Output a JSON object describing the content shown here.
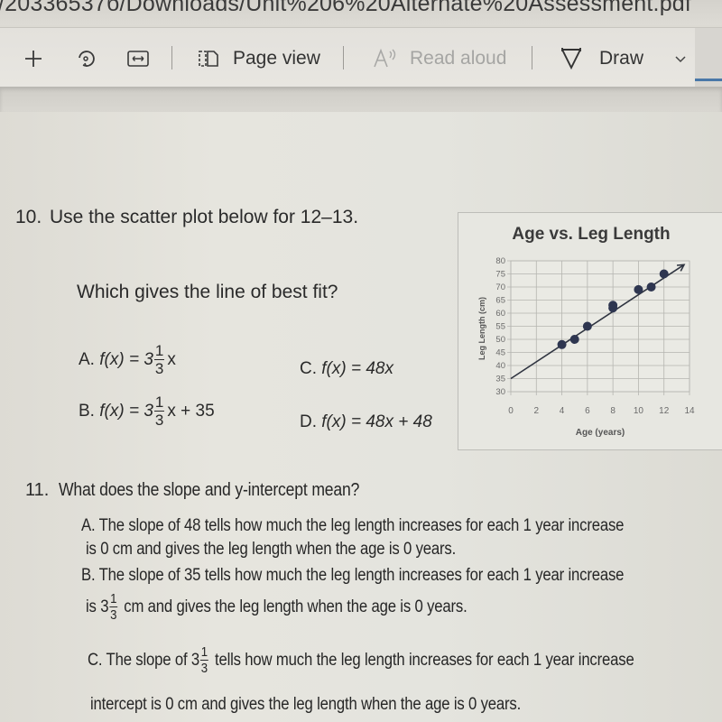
{
  "browser": {
    "url_text": "/20336537б/Downloads/Unit%206%20Alternate%20Assessment.pdf",
    "toolbar": {
      "page_view_label": "Page view",
      "read_aloud_label": "Read aloud",
      "draw_label": "Draw",
      "icons": [
        "plus-icon",
        "rotate-icon",
        "fit-width-icon",
        "page-view-icon",
        "read-aloud-icon",
        "draw-pen-icon",
        "chevron-down-icon"
      ]
    }
  },
  "document": {
    "q10": {
      "number": "10.",
      "prompt": "Use the scatter plot below for 12–13.",
      "question": "Which gives the line of best fit?",
      "choices": {
        "A": {
          "letter": "A.",
          "prefix": "f(x) = 3",
          "frac_num": "1",
          "frac_den": "3",
          "suffix": "x"
        },
        "B": {
          "letter": "B.",
          "prefix": "f(x) = 3",
          "frac_num": "1",
          "frac_den": "3",
          "suffix": "x + 35"
        },
        "C": {
          "letter": "C.",
          "text": "f(x) = 48x"
        },
        "D": {
          "letter": "D.",
          "text": "f(x) = 48x + 48"
        }
      }
    },
    "q11": {
      "number": "11.",
      "prompt": "What does the slope and y-intercept mean?",
      "A": {
        "line1": "A. The slope of 48 tells how much the leg length increases for each 1 year increase",
        "line2": "is 0 cm and gives the leg length when the age is 0 years."
      },
      "B": {
        "line1": "B. The slope of 35 tells how much the leg length increases for each 1 year increase",
        "line2_prefix": "is 3",
        "frac_num": "1",
        "frac_den": "3",
        "line2_suffix": "cm and gives the leg length when the age is 0 years."
      },
      "C": {
        "line1_prefix": "C. The slope of 3",
        "frac_num": "1",
        "frac_den": "3",
        "line1_suffix": "tells how much the leg length increases for each 1 year increase",
        "line2": "intercept is 0 cm and gives the leg length when the age is 0 years."
      }
    }
  },
  "chart_data": {
    "type": "scatter",
    "title": "Age vs. Leg Length",
    "xlabel": "Age (years)",
    "ylabel": "Leg Length (cm)",
    "xlim": [
      0,
      14
    ],
    "ylim": [
      30,
      80
    ],
    "xticks": [
      0,
      2,
      4,
      6,
      8,
      10,
      12,
      14
    ],
    "yticks": [
      30,
      35,
      40,
      45,
      50,
      55,
      60,
      65,
      70,
      75,
      80
    ],
    "grid": true,
    "points": [
      {
        "x": 4,
        "y": 48
      },
      {
        "x": 5,
        "y": 50
      },
      {
        "x": 6,
        "y": 55
      },
      {
        "x": 8,
        "y": 62
      },
      {
        "x": 8,
        "y": 63
      },
      {
        "x": 10,
        "y": 69
      },
      {
        "x": 11,
        "y": 70
      },
      {
        "x": 12,
        "y": 75
      }
    ],
    "trend_line": {
      "x0": 0,
      "y0": 35,
      "x1": 14,
      "y1": 80,
      "arrow_end": true
    }
  }
}
